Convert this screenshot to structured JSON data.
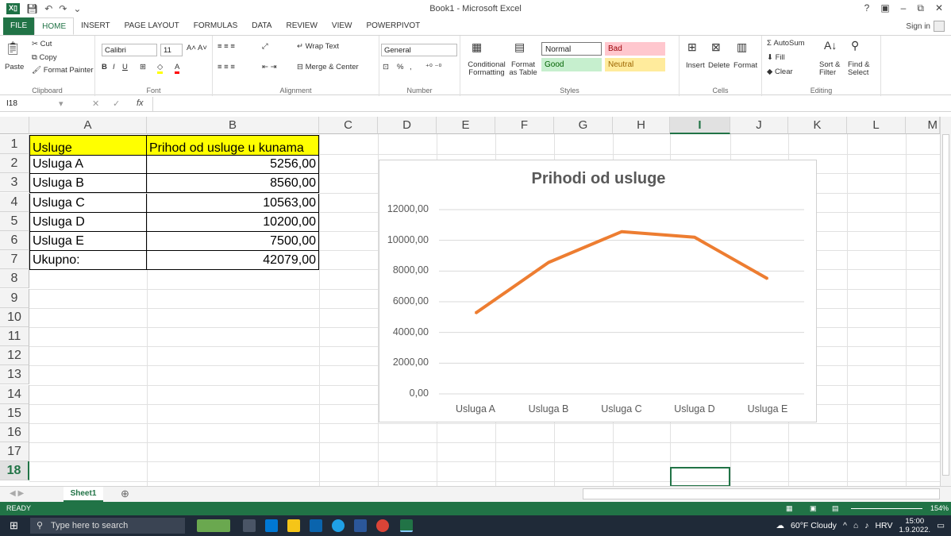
{
  "window": {
    "title": "Book1 - Microsoft Excel",
    "controls": [
      "?",
      "▣",
      "–",
      "⧉",
      "✕"
    ],
    "signin": "Sign in"
  },
  "tabs": [
    "FILE",
    "HOME",
    "INSERT",
    "PAGE LAYOUT",
    "FORMULAS",
    "DATA",
    "REVIEW",
    "VIEW",
    "POWERPIVOT"
  ],
  "active_tab": "HOME",
  "ribbon": {
    "clipboard": {
      "paste": "Paste",
      "cut": "Cut",
      "copy": "Copy",
      "format_painter": "Format Painter",
      "label": "Clipboard"
    },
    "font": {
      "name": "Calibri",
      "size": "11",
      "label": "Font"
    },
    "alignment": {
      "wrap": "Wrap Text",
      "merge": "Merge & Center",
      "label": "Alignment"
    },
    "number": {
      "format": "General",
      "percent": "%",
      "comma": ",",
      "label": "Number"
    },
    "styles": {
      "conditional": "Conditional Formatting",
      "format_table": "Format as Table",
      "normal": "Normal",
      "bad": "Bad",
      "good": "Good",
      "neutral": "Neutral",
      "label": "Styles"
    },
    "cells": {
      "insert": "Insert",
      "delete": "Delete",
      "format": "Format",
      "label": "Cells"
    },
    "editing": {
      "autosum": "AutoSum",
      "fill": "Fill",
      "clear": "Clear",
      "sort": "Sort & Filter",
      "find": "Find & Select",
      "label": "Editing"
    }
  },
  "formula_bar": {
    "name_box": "I18",
    "fx": "fx",
    "value": ""
  },
  "columns": [
    "A",
    "B",
    "C",
    "D",
    "E",
    "F",
    "G",
    "H",
    "I",
    "J",
    "K",
    "L",
    "M"
  ],
  "selected_column": "I",
  "rows": [
    "1",
    "2",
    "3",
    "4",
    "5",
    "6",
    "7",
    "8",
    "9",
    "10",
    "11",
    "12",
    "13",
    "14",
    "15",
    "16",
    "17",
    "18"
  ],
  "selected_row": "18",
  "table": {
    "header": [
      "Usluge",
      "Prihod od usluge u kunama"
    ],
    "rows": [
      [
        "Usluga A",
        "5256,00"
      ],
      [
        "Usluga B",
        "8560,00"
      ],
      [
        "Usluga C",
        "10563,00"
      ],
      [
        "Usluga D",
        "10200,00"
      ],
      [
        "Usluga E",
        "7500,00"
      ],
      [
        "Ukupno:",
        "42079,00"
      ]
    ]
  },
  "chart_data": {
    "type": "line",
    "title": "Prihodi od usluge",
    "categories": [
      "Usluga A",
      "Usluga B",
      "Usluga C",
      "Usluga D",
      "Usluga E"
    ],
    "series": [
      {
        "values": [
          5256,
          8560,
          10563,
          10200,
          7500
        ],
        "color": "#ed7d31"
      }
    ],
    "ylim": [
      0,
      12000
    ],
    "yticks": [
      "0,00",
      "2000,00",
      "4000,00",
      "6000,00",
      "8000,00",
      "10000,00",
      "12000,00"
    ],
    "grid": true
  },
  "sheet": {
    "tab": "Sheet1",
    "add": "⊕"
  },
  "status": {
    "mode": "READY",
    "zoom": "154%"
  },
  "taskbar": {
    "search_placeholder": "Type here to search",
    "weather": "60°F Cloudy",
    "lang": "HRV",
    "time": "15:00",
    "date": "1.9.2022."
  }
}
